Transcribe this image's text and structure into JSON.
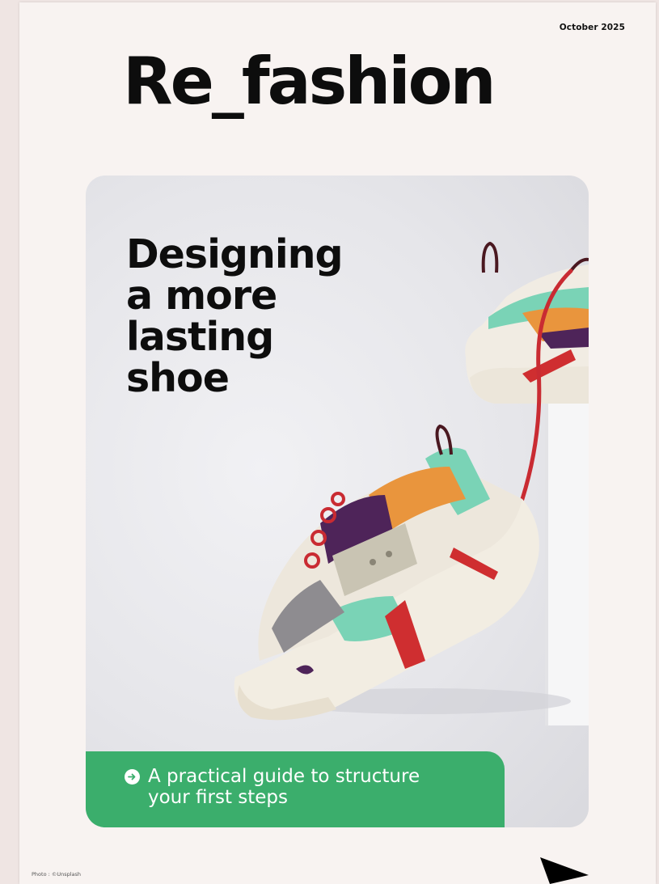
{
  "cover": {
    "date": "October 2025",
    "brand": "Re_fashion",
    "headline_lines": [
      "Designing",
      "a more",
      "lasting",
      "shoe"
    ],
    "cta_lines": [
      "A practical guide to structure",
      "your first steps"
    ],
    "photo_credit": "Photo : ©Unsplash"
  },
  "icons": {
    "cta": "arrow-right-circle-icon",
    "cursor": "mouse-pointer-icon"
  },
  "colors": {
    "page_background": "#f8f3f1",
    "outer_background": "#efe5e3",
    "cta_green": "#3bae6c",
    "text_dark": "#0d0d0d"
  }
}
